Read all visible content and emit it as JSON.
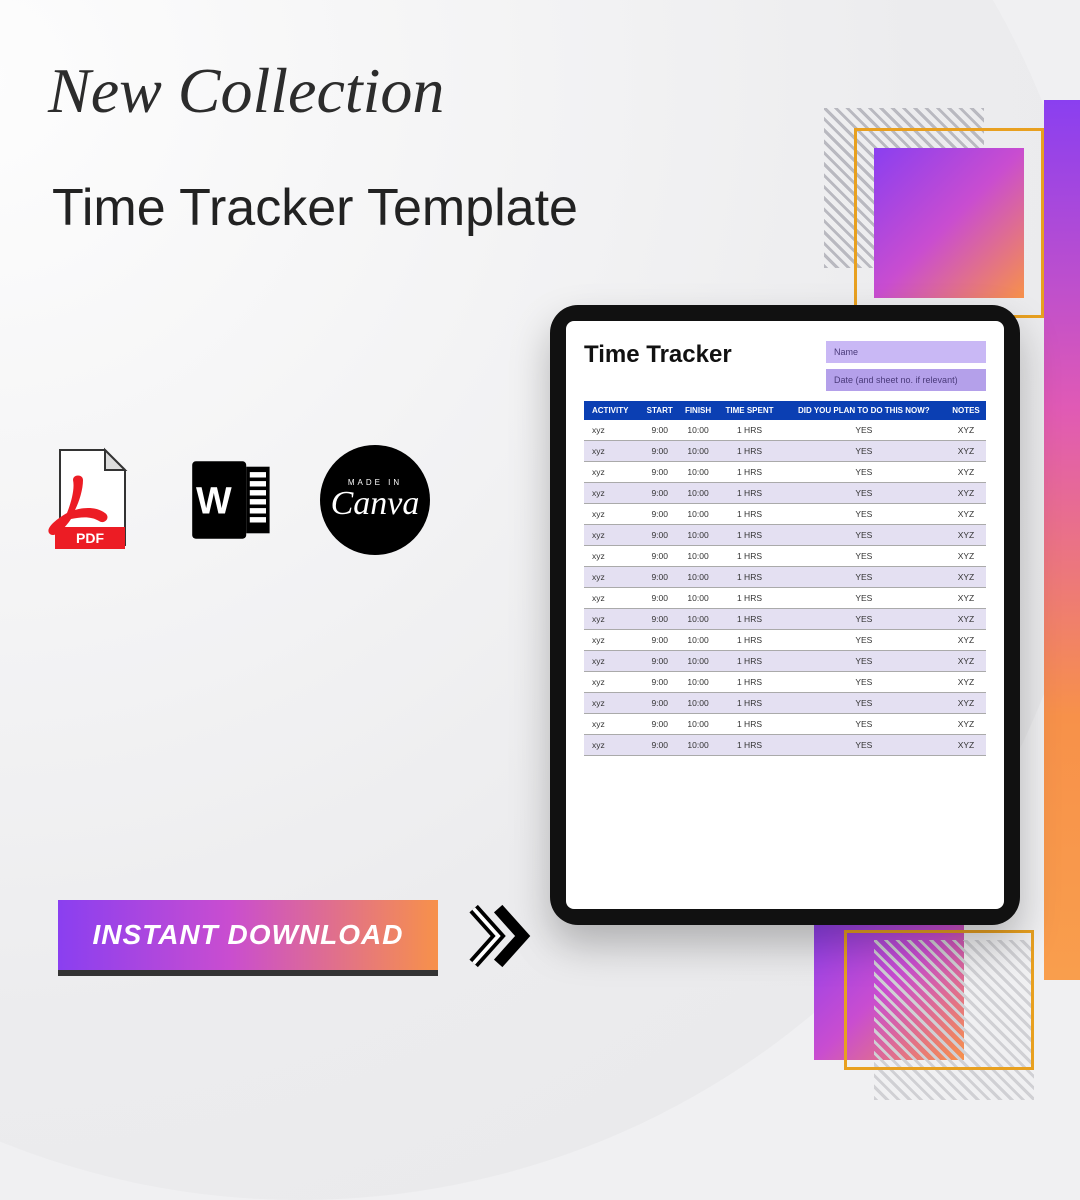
{
  "script_heading": "New Collection",
  "title": "Time Tracker Template",
  "formats": {
    "pdf_label": "PDF",
    "word_label": "W",
    "canva_top": "MADE IN",
    "canva_name": "Canva"
  },
  "cta": {
    "label": "INSTANT DOWNLOAD"
  },
  "document": {
    "title": "Time Tracker",
    "meta_name": "Name",
    "meta_date": "Date (and sheet no. if relevant)",
    "headers": [
      "ACTIVITY",
      "START",
      "FINISH",
      "TIME SPENT",
      "DID YOU PLAN TO DO THIS NOW?",
      "NOTES"
    ],
    "rows": [
      {
        "activity": "xyz",
        "start": "9:00",
        "finish": "10:00",
        "spent": "1 HRS",
        "plan": "YES",
        "notes": "XYZ"
      },
      {
        "activity": "xyz",
        "start": "9:00",
        "finish": "10:00",
        "spent": "1 HRS",
        "plan": "YES",
        "notes": "XYZ"
      },
      {
        "activity": "xyz",
        "start": "9:00",
        "finish": "10:00",
        "spent": "1 HRS",
        "plan": "YES",
        "notes": "XYZ"
      },
      {
        "activity": "xyz",
        "start": "9:00",
        "finish": "10:00",
        "spent": "1 HRS",
        "plan": "YES",
        "notes": "XYZ"
      },
      {
        "activity": "xyz",
        "start": "9:00",
        "finish": "10:00",
        "spent": "1 HRS",
        "plan": "YES",
        "notes": "XYZ"
      },
      {
        "activity": "xyz",
        "start": "9:00",
        "finish": "10:00",
        "spent": "1 HRS",
        "plan": "YES",
        "notes": "XYZ"
      },
      {
        "activity": "xyz",
        "start": "9:00",
        "finish": "10:00",
        "spent": "1 HRS",
        "plan": "YES",
        "notes": "XYZ"
      },
      {
        "activity": "xyz",
        "start": "9:00",
        "finish": "10:00",
        "spent": "1 HRS",
        "plan": "YES",
        "notes": "XYZ"
      },
      {
        "activity": "xyz",
        "start": "9:00",
        "finish": "10:00",
        "spent": "1 HRS",
        "plan": "YES",
        "notes": "XYZ"
      },
      {
        "activity": "xyz",
        "start": "9:00",
        "finish": "10:00",
        "spent": "1 HRS",
        "plan": "YES",
        "notes": "XYZ"
      },
      {
        "activity": "xyz",
        "start": "9:00",
        "finish": "10:00",
        "spent": "1 HRS",
        "plan": "YES",
        "notes": "XYZ"
      },
      {
        "activity": "xyz",
        "start": "9:00",
        "finish": "10:00",
        "spent": "1 HRS",
        "plan": "YES",
        "notes": "XYZ"
      },
      {
        "activity": "xyz",
        "start": "9:00",
        "finish": "10:00",
        "spent": "1 HRS",
        "plan": "YES",
        "notes": "XYZ"
      },
      {
        "activity": "xyz",
        "start": "9:00",
        "finish": "10:00",
        "spent": "1 HRS",
        "plan": "YES",
        "notes": "XYZ"
      },
      {
        "activity": "xyz",
        "start": "9:00",
        "finish": "10:00",
        "spent": "1 HRS",
        "plan": "YES",
        "notes": "XYZ"
      },
      {
        "activity": "xyz",
        "start": "9:00",
        "finish": "10:00",
        "spent": "1 HRS",
        "plan": "YES",
        "notes": "XYZ"
      }
    ]
  }
}
